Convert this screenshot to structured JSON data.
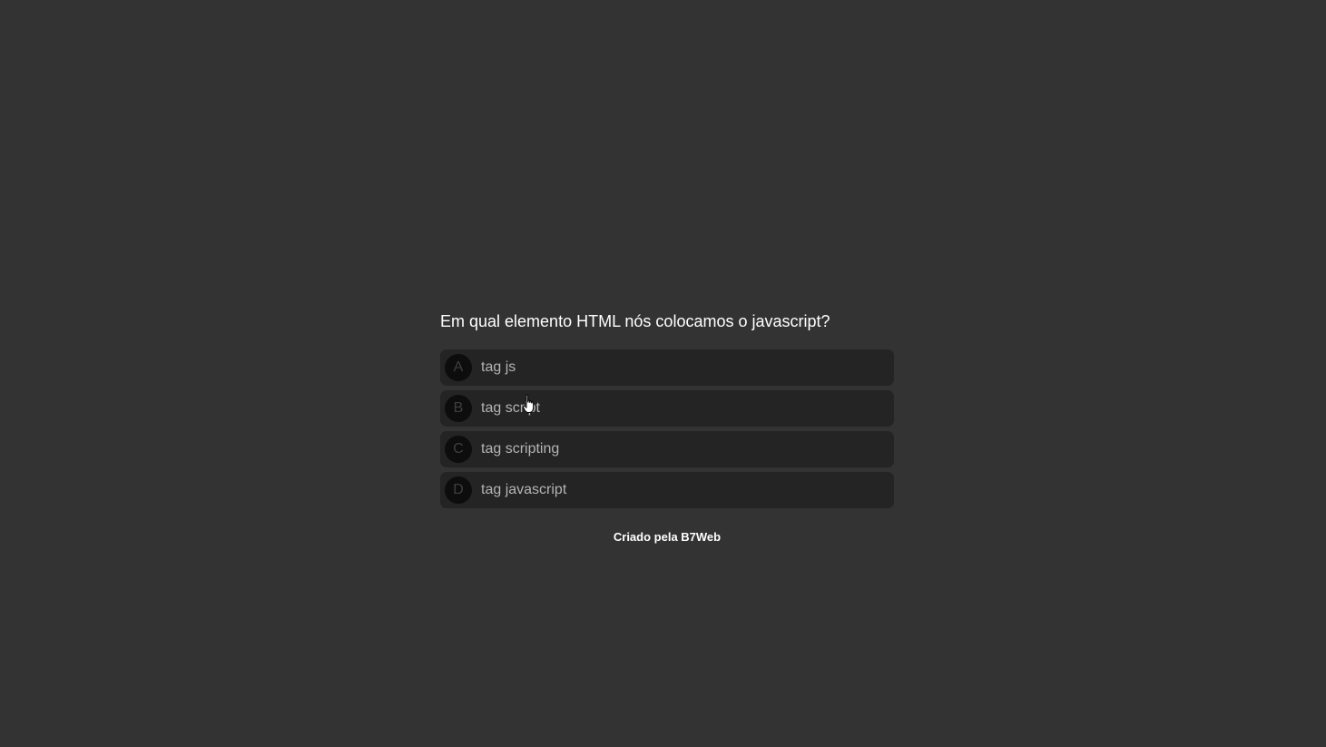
{
  "quiz": {
    "question": "Em qual elemento HTML nós colocamos o javascript?",
    "options": [
      {
        "letter": "A",
        "text": "tag js"
      },
      {
        "letter": "B",
        "text": "tag script"
      },
      {
        "letter": "C",
        "text": "tag scripting"
      },
      {
        "letter": "D",
        "text": "tag javascript"
      }
    ]
  },
  "footer": {
    "credit": "Criado pela B7Web"
  },
  "colors": {
    "background": "#333333",
    "option_bg": "#242424",
    "letter_bg": "#0d0d0d",
    "question_text": "#ffffff",
    "option_text": "#b4b4b4"
  },
  "icons": {
    "cursor": "hand-pointer-icon"
  }
}
